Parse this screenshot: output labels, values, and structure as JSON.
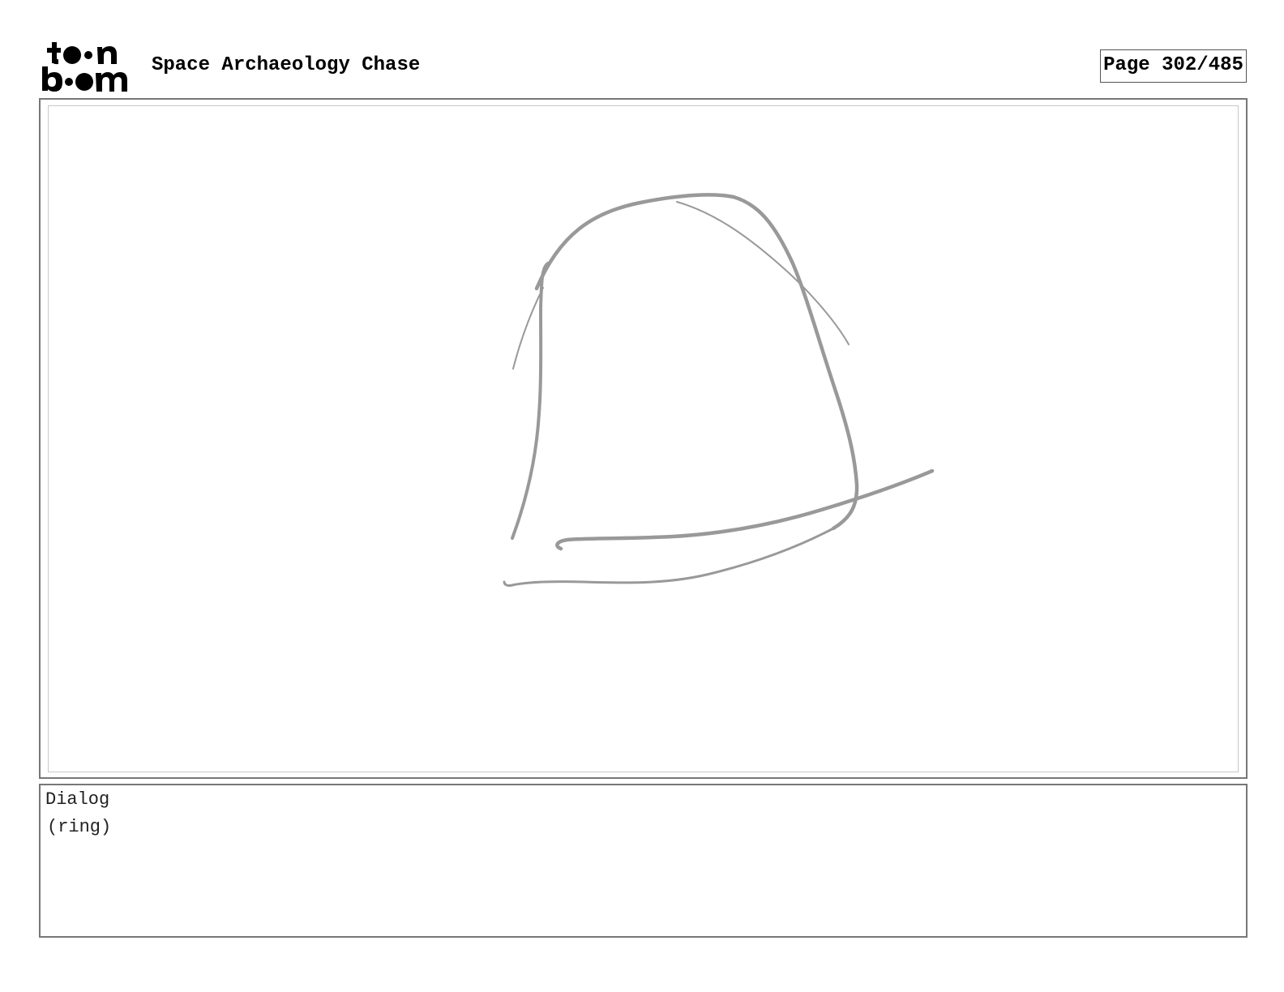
{
  "header": {
    "logo_alt": "toon boom",
    "project_title": "Space Archaeology Chase",
    "page_number": "Page 302/485"
  },
  "panel": {
    "sketch_color": "#999999"
  },
  "dialog": {
    "label": "Dialog",
    "text": "(ring)"
  }
}
